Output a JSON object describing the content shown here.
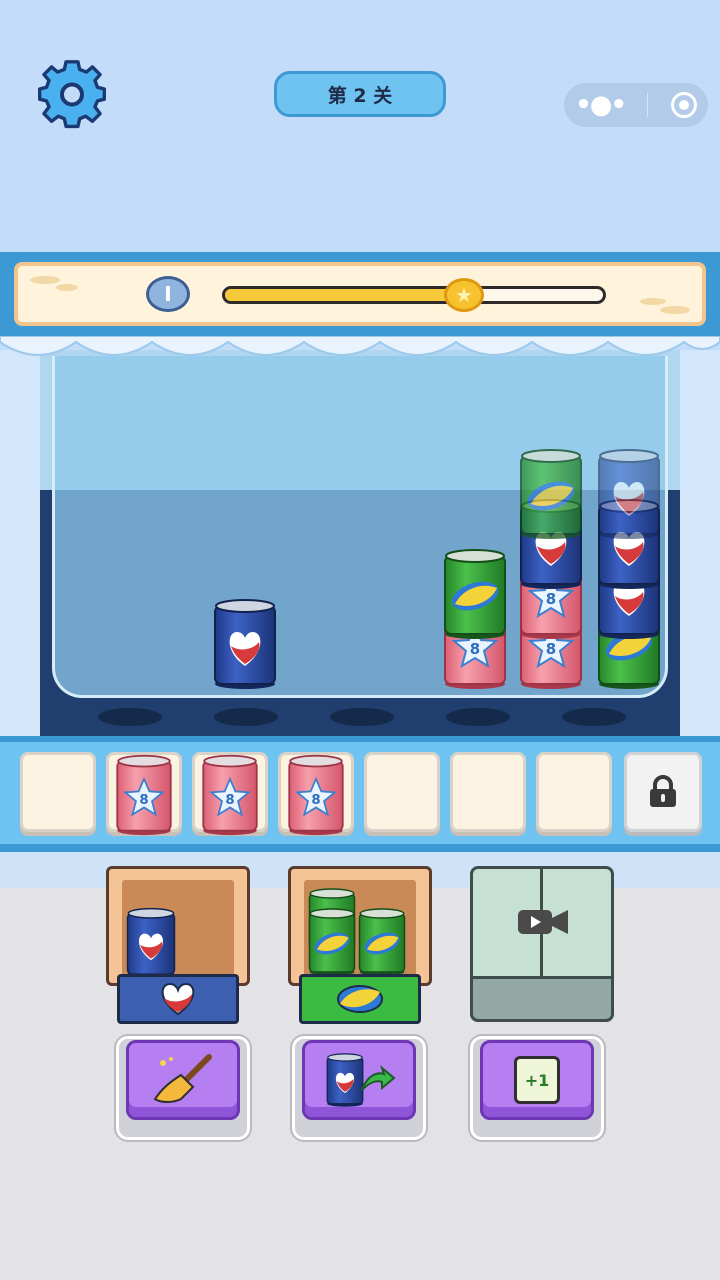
{
  "header": {
    "level_label": "第 2 关",
    "settings_icon": "gear-icon",
    "capsule_icons": [
      "more-icon",
      "target-icon"
    ]
  },
  "progress": {
    "coin_label": "I",
    "value": 0.63,
    "marker_icon": "star-icon"
  },
  "colors": {
    "blue_can": "#2f4fa4",
    "red_can": "#ef7a8b",
    "green_can": "#3aa83a",
    "accent": "#3d99d4"
  },
  "shelf": {
    "columns": [
      {
        "cans": []
      },
      {
        "cans": [
          "blue"
        ]
      },
      {
        "cans": []
      },
      {
        "cans": [
          "red",
          "green"
        ]
      },
      {
        "cans": [
          "red",
          "red",
          "blue",
          "green"
        ]
      },
      {
        "cans": [
          "green",
          "blue",
          "blue",
          "blue"
        ]
      }
    ]
  },
  "slots": {
    "items": [
      "",
      "red",
      "red",
      "red",
      "",
      "",
      ""
    ],
    "locked_icon": "lock-icon"
  },
  "boxes": [
    {
      "label_icon": "heart-logo-icon",
      "contents": [
        "blue"
      ]
    },
    {
      "label_icon": "leaf-logo-icon",
      "contents": [
        "green",
        "green",
        "green"
      ]
    },
    {
      "label_icon": "video-camera-icon",
      "contents": []
    }
  ],
  "powerups": [
    {
      "icon": "broom-icon"
    },
    {
      "icon": "can-swap-icon"
    },
    {
      "icon": "plus-one-card-icon",
      "label": "+1"
    }
  ]
}
